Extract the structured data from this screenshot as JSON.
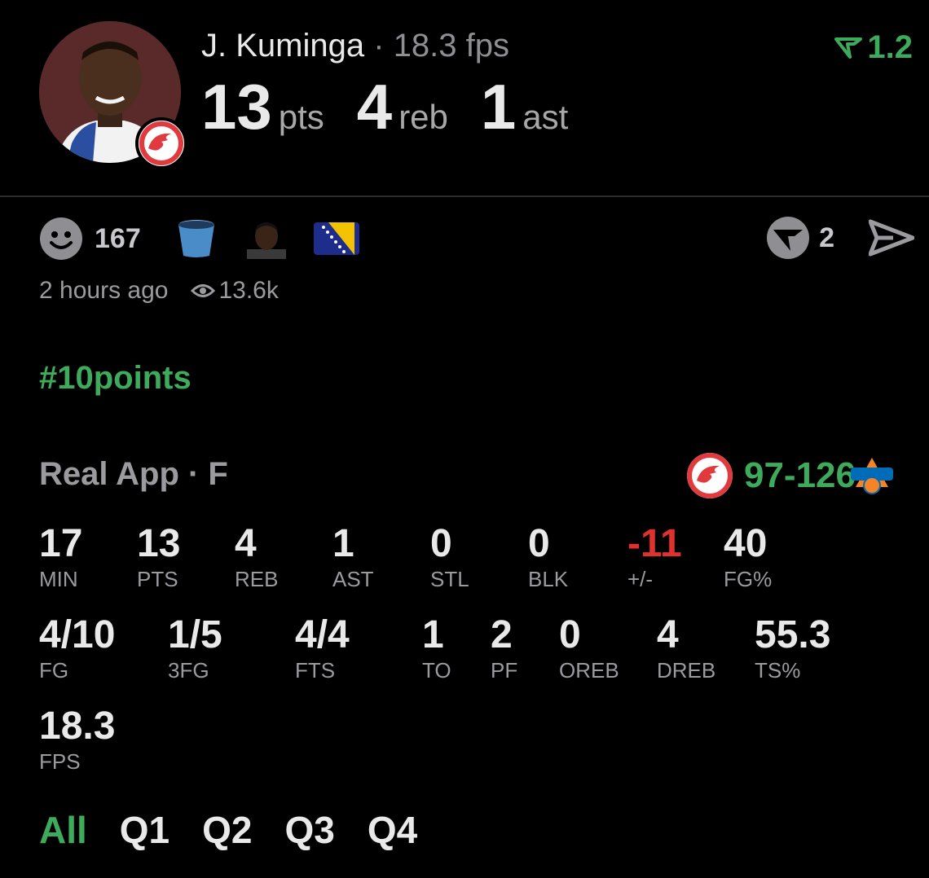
{
  "player": {
    "name": "J. Kuminga",
    "separator": "·",
    "fps_text": "18.3 fps",
    "stats": [
      {
        "value": "13",
        "unit": "pts"
      },
      {
        "value": "4",
        "unit": "reb"
      },
      {
        "value": "1",
        "unit": "ast"
      }
    ]
  },
  "boost": {
    "value": "1.2",
    "icon": "boost-v-icon",
    "color": "#3daa5c"
  },
  "reactions": {
    "count": "167"
  },
  "actions": {
    "count": "2"
  },
  "meta": {
    "time_ago": "2 hours ago",
    "views": "13.6k"
  },
  "hashtag": "#10points",
  "game": {
    "source": "Real App · F",
    "score": "97-126"
  },
  "box_score": [
    {
      "value": "17",
      "label": "MIN"
    },
    {
      "value": "13",
      "label": "PTS"
    },
    {
      "value": "4",
      "label": "REB"
    },
    {
      "value": "1",
      "label": "AST"
    },
    {
      "value": "0",
      "label": "STL"
    },
    {
      "value": "0",
      "label": "BLK"
    },
    {
      "value": "-11",
      "label": "+/-"
    },
    {
      "value": "40",
      "label": "FG%"
    },
    {
      "value": "4/10",
      "label": "FG"
    },
    {
      "value": "1/5",
      "label": "3FG"
    },
    {
      "value": "4/4",
      "label": "FTS"
    },
    {
      "value": "1",
      "label": "TO"
    },
    {
      "value": "2",
      "label": "PF"
    },
    {
      "value": "0",
      "label": "OREB"
    },
    {
      "value": "4",
      "label": "DREB"
    },
    {
      "value": "55.3",
      "label": "TS%"
    },
    {
      "value": "18.3",
      "label": "FPS"
    }
  ],
  "tabs": [
    "All",
    "Q1",
    "Q2",
    "Q3",
    "Q4"
  ],
  "colors": {
    "accent": "#3daa5c",
    "negative": "#e0312f",
    "background": "#000000"
  }
}
